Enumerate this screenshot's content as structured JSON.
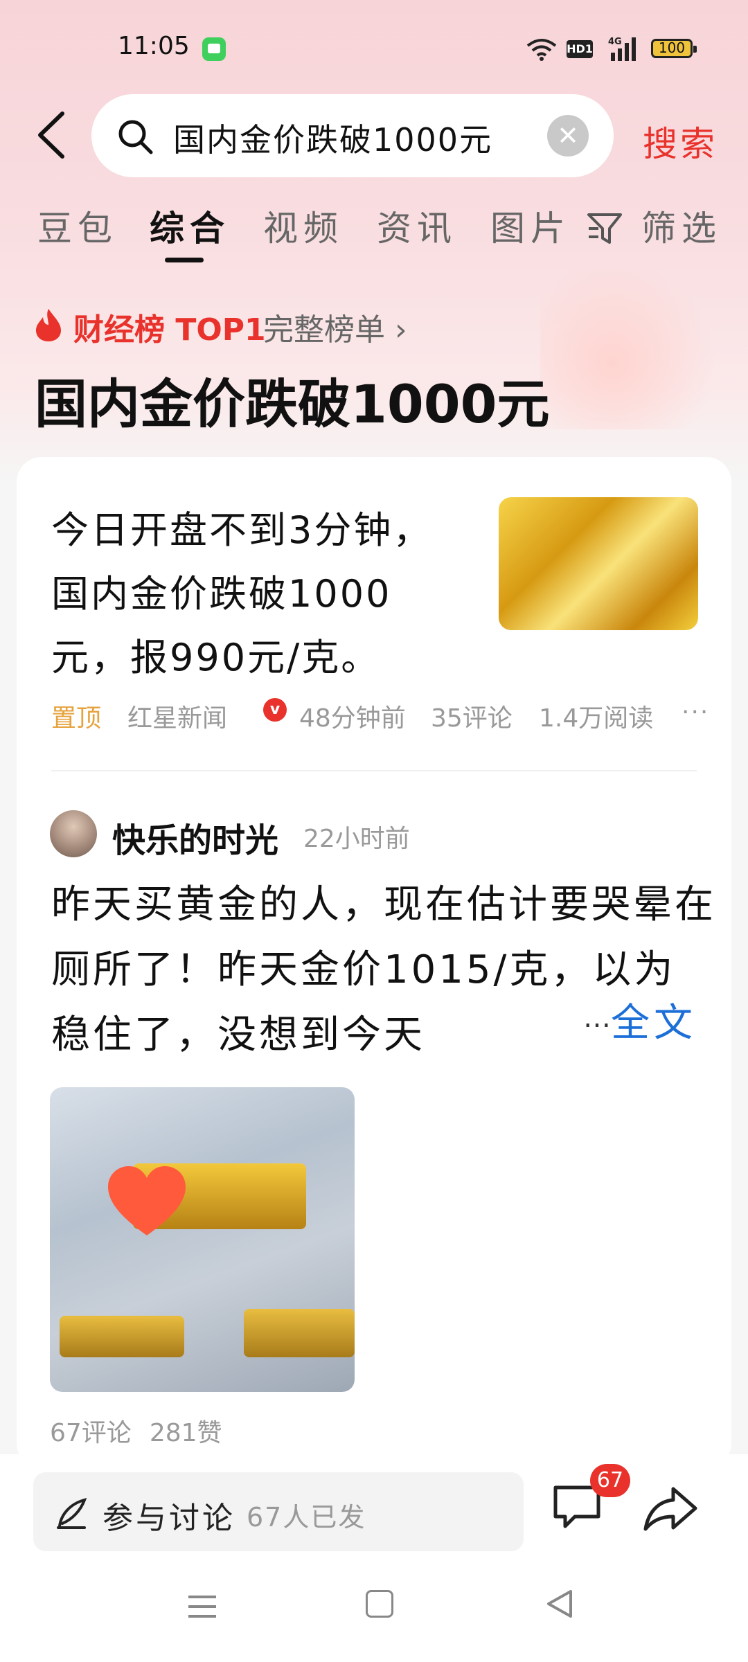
{
  "status_bar": {
    "time": "11:05",
    "battery": "100",
    "network": "4G",
    "hd": "HD1"
  },
  "search": {
    "query": "国内金价跌破1000元",
    "search_button": "搜索"
  },
  "tabs": [
    {
      "label": "豆包"
    },
    {
      "label": "综合"
    },
    {
      "label": "视频"
    },
    {
      "label": "资讯"
    },
    {
      "label": "图片"
    },
    {
      "label": "筛选"
    }
  ],
  "ranking": {
    "label": "财经榜 TOP1",
    "link": "完整榜单 ›"
  },
  "headline": "国内金价跌破1000元",
  "news": {
    "text": "今日开盘不到3分钟，国内金价跌破1000元，报990元/克。",
    "pin": "置顶",
    "source": "红星新闻",
    "verified": "v",
    "time": "48分钟前",
    "comments": "35评论",
    "reads": "1.4万阅读",
    "more": "···"
  },
  "post": {
    "user": "快乐的时光",
    "time": "22小时前",
    "text": "昨天买黄金的人，现在估计要哭晕在厕所了！昨天金价1015/克，以为稳住了，没想到今天",
    "ellipsis": "…",
    "full_text_link": "全文",
    "comments": "67评论",
    "likes": "281赞"
  },
  "bottom_bar": {
    "discuss_label": "参与讨论",
    "discuss_count": "67人已发",
    "comment_badge": "67"
  },
  "colors": {
    "accent_red": "#e8322b",
    "link_blue": "#1d6fd8",
    "pin_orange": "#e6a23c"
  }
}
